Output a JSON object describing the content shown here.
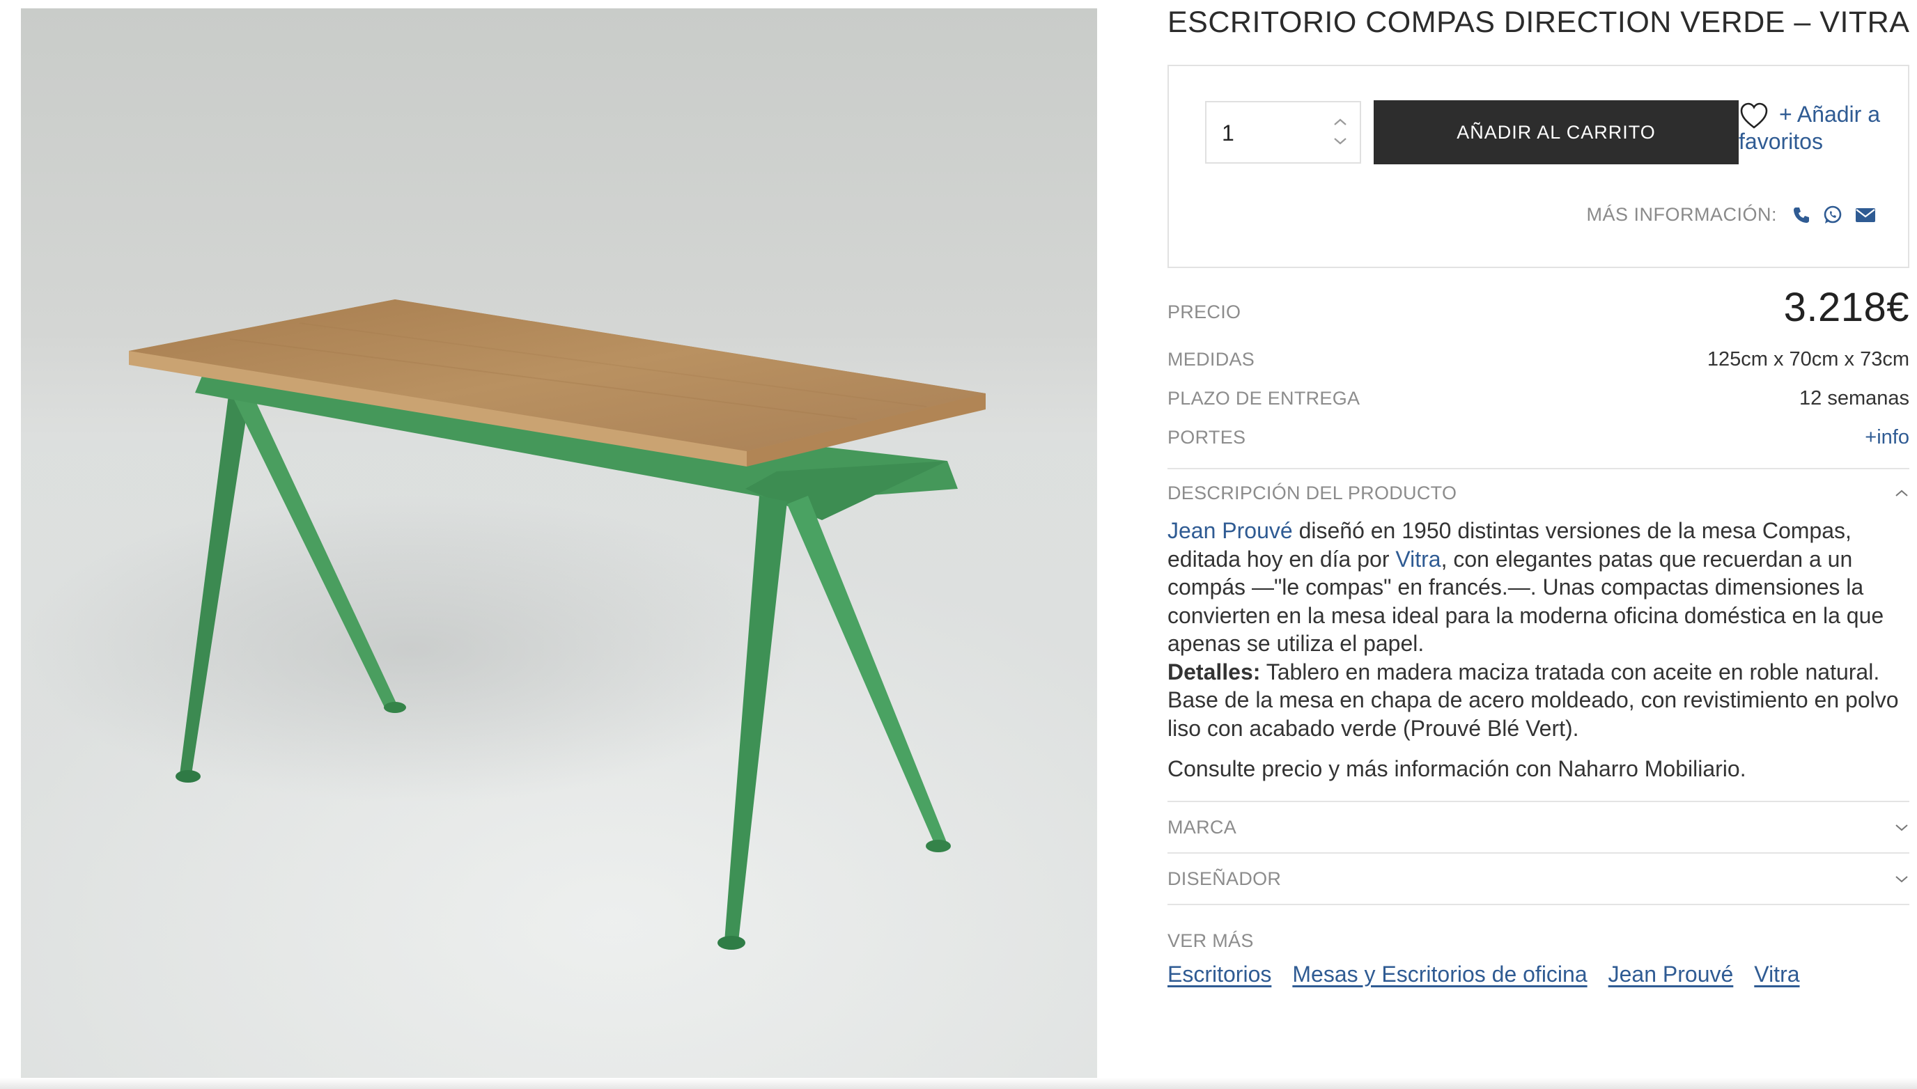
{
  "product": {
    "title": "ESCRITORIO COMPAS DIRECTION VERDE – VITRA",
    "image_alt": "Escritorio Compas Direction verde con tablero de roble"
  },
  "buybox": {
    "quantity": "1",
    "add_to_cart": "AÑADIR AL CARRITO",
    "favorites": "+ Añadir a favoritos",
    "more_info_label": "MÁS INFORMACIÓN:",
    "contact_icons": [
      "phone-icon",
      "whatsapp-icon",
      "envelope-icon"
    ]
  },
  "specs": {
    "price_label": "PRECIO",
    "price_value": "3.218€",
    "dimensions_label": "MEDIDAS",
    "dimensions_value": "125cm x 70cm x 73cm",
    "delivery_label": "PLAZO DE ENTREGA",
    "delivery_value": "12 semanas",
    "shipping_label": "PORTES",
    "shipping_value": "+info"
  },
  "description": {
    "heading": "DESCRIPCIÓN DEL PRODUCTO",
    "expanded": true,
    "designer_link": "Jean Prouvé",
    "text_1": " diseñó en 1950 distintas versiones de la mesa Compas, editada hoy en día por ",
    "brand_link": "Vitra",
    "text_2": ", con elegantes patas que recuerdan a un compás —\"le compas\" en francés.—. Unas compactas dimensiones la convierten en la mesa ideal para la moderna oficina doméstica en la que apenas se utiliza el papel.",
    "details_label": "Detalles:",
    "details_text": " Tablero en madera maciza tratada con aceite en roble natural. Base de la mesa en chapa de acero moldeado, con revistimiento en polvo liso con acabado verde (Prouvé Blé Vert).",
    "consult": "Consulte precio y más información con Naharro Mobiliario."
  },
  "accordions": {
    "brand": "MARCA",
    "designer": "DISEÑADOR"
  },
  "see_more": {
    "label": "VER MÁS",
    "tags": [
      "Escritorios",
      "Mesas y Escritorios de oficina",
      "Jean Prouvé",
      "Vitra"
    ]
  },
  "colors": {
    "link": "#2f5b93",
    "button": "#2d2d2d",
    "table_green": "#3f9556",
    "wood": "#b88e5e"
  }
}
